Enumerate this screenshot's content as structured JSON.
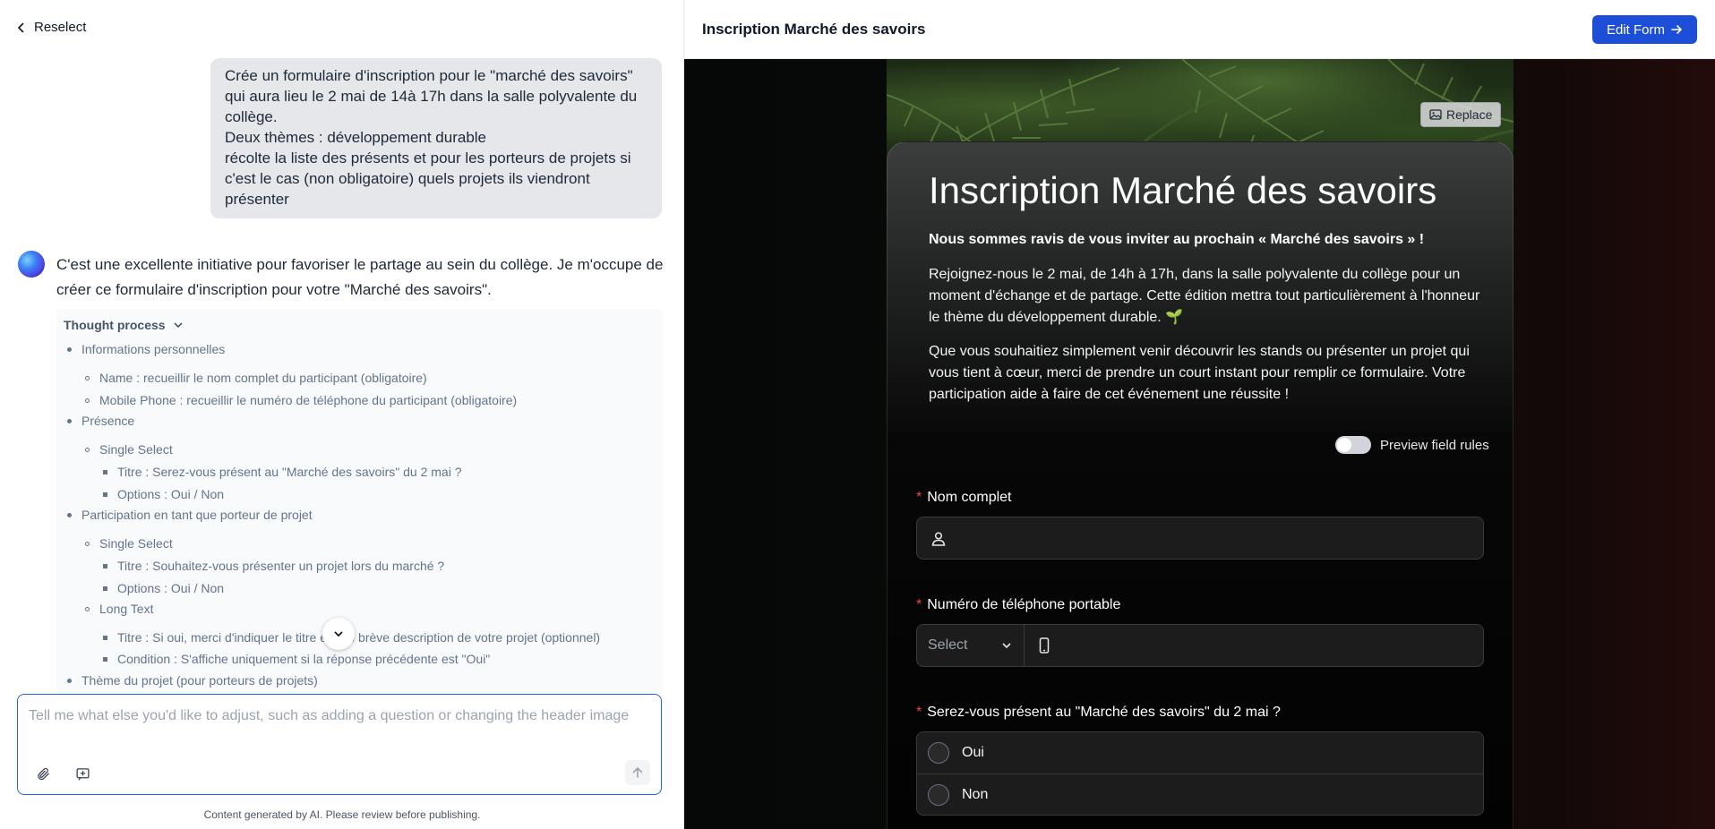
{
  "left": {
    "reselect_label": "Reselect",
    "user_message": [
      "Crée un formulaire d'inscription pour le \"marché des savoirs\"",
      "qui aura lieu le 2 mai de 14à 17h dans la salle polyvalente du",
      "collège.",
      "Deux thèmes : développement durable",
      "récolte la liste des présents et pour les porteurs de projets si",
      "c'est le cas (non obligatoire) quels projets ils viendront",
      "présenter"
    ],
    "ai_message": "C'est une excellente initiative pour favoriser le partage au sein du collège. Je m'occupe de créer ce formulaire d'inscription pour votre \"Marché des savoirs\".",
    "thought_process": {
      "label": "Thought process",
      "lines": [
        "Informations personnelles",
        "Name : recueillir le nom complet du participant (obligatoire)",
        "Mobile Phone : recueillir le numéro de téléphone du participant (obligatoire)",
        "Présence",
        "Single Select",
        "Titre : Serez-vous présent au \"Marché des savoirs\" du 2 mai ?",
        "Options : Oui / Non",
        "Participation en tant que porteur de projet",
        "Single Select",
        "Titre : Souhaitez-vous présenter un projet lors du marché ?",
        "Options : Oui / Non",
        "Long Text",
        "Titre : Si oui, merci d'indiquer le titre et une brève description de votre projet (optionnel)",
        "Condition : S'affiche uniquement si la réponse précédente est \"Oui\"",
        "Thème du projet (pour porteurs de projets)"
      ]
    },
    "composer": {
      "placeholder": "Tell me what else you'd like to adjust, such as adding a question or changing the header image"
    },
    "disclaimer": "Content generated by AI. Please review before publishing."
  },
  "right": {
    "header_title": "Inscription Marché des savoirs",
    "edit_button": "Edit Form",
    "replace_button": "Replace",
    "form": {
      "title": "Inscription Marché des savoirs",
      "lead": "Nous sommes ravis de vous inviter au prochain « Marché des savoirs » !",
      "paragraph1": "Rejoignez-nous le 2 mai, de 14h à 17h, dans la salle polyvalente du collège pour un moment d'échange et de partage. Cette édition mettra tout particulièrement à l'honneur le thème du développement durable. 🌱",
      "paragraph2": "Que vous souhaitiez simplement venir découvrir les stands ou présenter un projet qui vous tient à cœur, merci de prendre un court instant pour remplir ce formulaire. Votre participation aide à faire de cet événement une réussite !",
      "preview_rules_label": "Preview field rules",
      "fields": {
        "name_label": "Nom complet",
        "phone_label": "Numéro de téléphone portable",
        "phone_select": "Select",
        "presence_label": "Serez-vous présent au \"Marché des savoirs\" du 2 mai ?",
        "presence_options": [
          "Oui",
          "Non"
        ]
      }
    }
  },
  "colors": {
    "accent": "#1d4ed8",
    "required": "#ef4444",
    "composer_border": "#2563eb"
  }
}
